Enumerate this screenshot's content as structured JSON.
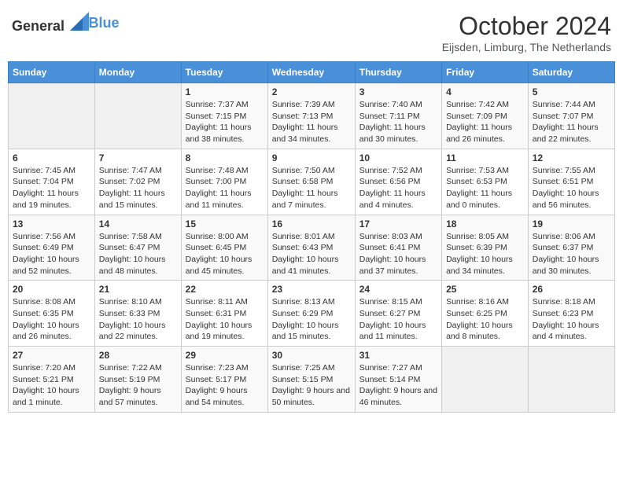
{
  "header": {
    "logo_general": "General",
    "logo_blue": "Blue",
    "title": "October 2024",
    "subtitle": "Eijsden, Limburg, The Netherlands"
  },
  "weekdays": [
    "Sunday",
    "Monday",
    "Tuesday",
    "Wednesday",
    "Thursday",
    "Friday",
    "Saturday"
  ],
  "weeks": [
    [
      {
        "day": "",
        "info": ""
      },
      {
        "day": "",
        "info": ""
      },
      {
        "day": "1",
        "info": "Sunrise: 7:37 AM\nSunset: 7:15 PM\nDaylight: 11 hours and 38 minutes."
      },
      {
        "day": "2",
        "info": "Sunrise: 7:39 AM\nSunset: 7:13 PM\nDaylight: 11 hours and 34 minutes."
      },
      {
        "day": "3",
        "info": "Sunrise: 7:40 AM\nSunset: 7:11 PM\nDaylight: 11 hours and 30 minutes."
      },
      {
        "day": "4",
        "info": "Sunrise: 7:42 AM\nSunset: 7:09 PM\nDaylight: 11 hours and 26 minutes."
      },
      {
        "day": "5",
        "info": "Sunrise: 7:44 AM\nSunset: 7:07 PM\nDaylight: 11 hours and 22 minutes."
      }
    ],
    [
      {
        "day": "6",
        "info": "Sunrise: 7:45 AM\nSunset: 7:04 PM\nDaylight: 11 hours and 19 minutes."
      },
      {
        "day": "7",
        "info": "Sunrise: 7:47 AM\nSunset: 7:02 PM\nDaylight: 11 hours and 15 minutes."
      },
      {
        "day": "8",
        "info": "Sunrise: 7:48 AM\nSunset: 7:00 PM\nDaylight: 11 hours and 11 minutes."
      },
      {
        "day": "9",
        "info": "Sunrise: 7:50 AM\nSunset: 6:58 PM\nDaylight: 11 hours and 7 minutes."
      },
      {
        "day": "10",
        "info": "Sunrise: 7:52 AM\nSunset: 6:56 PM\nDaylight: 11 hours and 4 minutes."
      },
      {
        "day": "11",
        "info": "Sunrise: 7:53 AM\nSunset: 6:53 PM\nDaylight: 11 hours and 0 minutes."
      },
      {
        "day": "12",
        "info": "Sunrise: 7:55 AM\nSunset: 6:51 PM\nDaylight: 10 hours and 56 minutes."
      }
    ],
    [
      {
        "day": "13",
        "info": "Sunrise: 7:56 AM\nSunset: 6:49 PM\nDaylight: 10 hours and 52 minutes."
      },
      {
        "day": "14",
        "info": "Sunrise: 7:58 AM\nSunset: 6:47 PM\nDaylight: 10 hours and 48 minutes."
      },
      {
        "day": "15",
        "info": "Sunrise: 8:00 AM\nSunset: 6:45 PM\nDaylight: 10 hours and 45 minutes."
      },
      {
        "day": "16",
        "info": "Sunrise: 8:01 AM\nSunset: 6:43 PM\nDaylight: 10 hours and 41 minutes."
      },
      {
        "day": "17",
        "info": "Sunrise: 8:03 AM\nSunset: 6:41 PM\nDaylight: 10 hours and 37 minutes."
      },
      {
        "day": "18",
        "info": "Sunrise: 8:05 AM\nSunset: 6:39 PM\nDaylight: 10 hours and 34 minutes."
      },
      {
        "day": "19",
        "info": "Sunrise: 8:06 AM\nSunset: 6:37 PM\nDaylight: 10 hours and 30 minutes."
      }
    ],
    [
      {
        "day": "20",
        "info": "Sunrise: 8:08 AM\nSunset: 6:35 PM\nDaylight: 10 hours and 26 minutes."
      },
      {
        "day": "21",
        "info": "Sunrise: 8:10 AM\nSunset: 6:33 PM\nDaylight: 10 hours and 22 minutes."
      },
      {
        "day": "22",
        "info": "Sunrise: 8:11 AM\nSunset: 6:31 PM\nDaylight: 10 hours and 19 minutes."
      },
      {
        "day": "23",
        "info": "Sunrise: 8:13 AM\nSunset: 6:29 PM\nDaylight: 10 hours and 15 minutes."
      },
      {
        "day": "24",
        "info": "Sunrise: 8:15 AM\nSunset: 6:27 PM\nDaylight: 10 hours and 11 minutes."
      },
      {
        "day": "25",
        "info": "Sunrise: 8:16 AM\nSunset: 6:25 PM\nDaylight: 10 hours and 8 minutes."
      },
      {
        "day": "26",
        "info": "Sunrise: 8:18 AM\nSunset: 6:23 PM\nDaylight: 10 hours and 4 minutes."
      }
    ],
    [
      {
        "day": "27",
        "info": "Sunrise: 7:20 AM\nSunset: 5:21 PM\nDaylight: 10 hours and 1 minute."
      },
      {
        "day": "28",
        "info": "Sunrise: 7:22 AM\nSunset: 5:19 PM\nDaylight: 9 hours and 57 minutes."
      },
      {
        "day": "29",
        "info": "Sunrise: 7:23 AM\nSunset: 5:17 PM\nDaylight: 9 hours and 54 minutes."
      },
      {
        "day": "30",
        "info": "Sunrise: 7:25 AM\nSunset: 5:15 PM\nDaylight: 9 hours and 50 minutes."
      },
      {
        "day": "31",
        "info": "Sunrise: 7:27 AM\nSunset: 5:14 PM\nDaylight: 9 hours and 46 minutes."
      },
      {
        "day": "",
        "info": ""
      },
      {
        "day": "",
        "info": ""
      }
    ]
  ]
}
